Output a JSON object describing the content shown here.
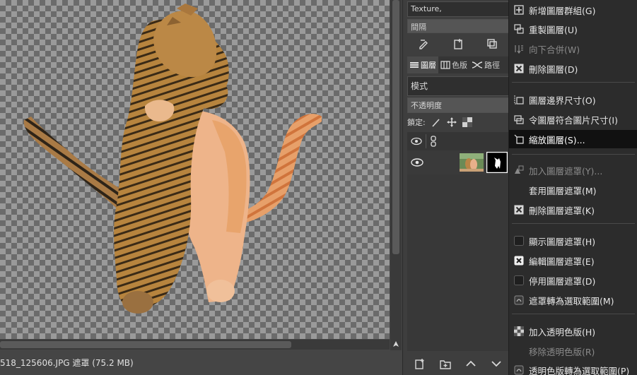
{
  "canvas": {
    "status_text": "518_125606.JPG 遮罩 (75.2 MB)"
  },
  "dock": {
    "brush_name": "Texture,",
    "spacing_label": "間隔",
    "tabs": [
      {
        "label": "圖層",
        "icon": "layers-icon",
        "active": true
      },
      {
        "label": "色版",
        "icon": "channels-icon",
        "active": false
      },
      {
        "label": "路徑",
        "icon": "paths-icon",
        "active": false
      }
    ],
    "mode_label": "模式",
    "opacity_label": "不透明度",
    "lock_label": "鎖定:"
  },
  "menu": {
    "items": [
      {
        "label": "新增圖層群組(G)",
        "icon": "new-group-icon",
        "disabled": false
      },
      {
        "label": "重製圖層(U)",
        "icon": "duplicate-icon",
        "disabled": false
      },
      {
        "label": "向下合併(W)",
        "icon": "merge-down-icon",
        "disabled": true
      },
      {
        "label": "刪除圖層(D)",
        "icon": "delete-icon",
        "disabled": false
      },
      {
        "label": "圖層邊界尺寸(O)",
        "icon": "layer-boundary-icon",
        "disabled": false
      },
      {
        "label": "令圖層符合圖片尺寸(I)",
        "icon": "layer-to-image-icon",
        "disabled": false
      },
      {
        "label": "縮放圖層(S)...",
        "icon": "scale-layer-icon",
        "disabled": false,
        "highlight": true
      },
      {
        "label": "加入圖層遮罩(Y)...",
        "icon": "add-mask-icon",
        "disabled": true
      },
      {
        "label": "套用圖層遮罩(M)",
        "icon": "",
        "disabled": false
      },
      {
        "label": "刪除圖層遮罩(K)",
        "icon": "delete-icon",
        "disabled": false
      },
      {
        "label": "顯示圖層遮罩(H)",
        "icon": "checkbox-icon",
        "disabled": false,
        "checked": false
      },
      {
        "label": "編輯圖層遮罩(E)",
        "icon": "checkbox-icon",
        "disabled": false,
        "checked": true
      },
      {
        "label": "停用圖層遮罩(D)",
        "icon": "checkbox-icon",
        "disabled": false,
        "checked": false
      },
      {
        "label": "遮罩轉為選取範圍(M)",
        "icon": "mask-to-selection-icon",
        "disabled": false
      },
      {
        "label": "加入透明色版(H)",
        "icon": "alpha-icon",
        "disabled": false
      },
      {
        "label": "移除透明色版(R)",
        "icon": "",
        "disabled": true
      },
      {
        "label": "透明色版轉為選取範圍(P)",
        "icon": "alpha-to-selection-icon",
        "disabled": false
      }
    ]
  }
}
